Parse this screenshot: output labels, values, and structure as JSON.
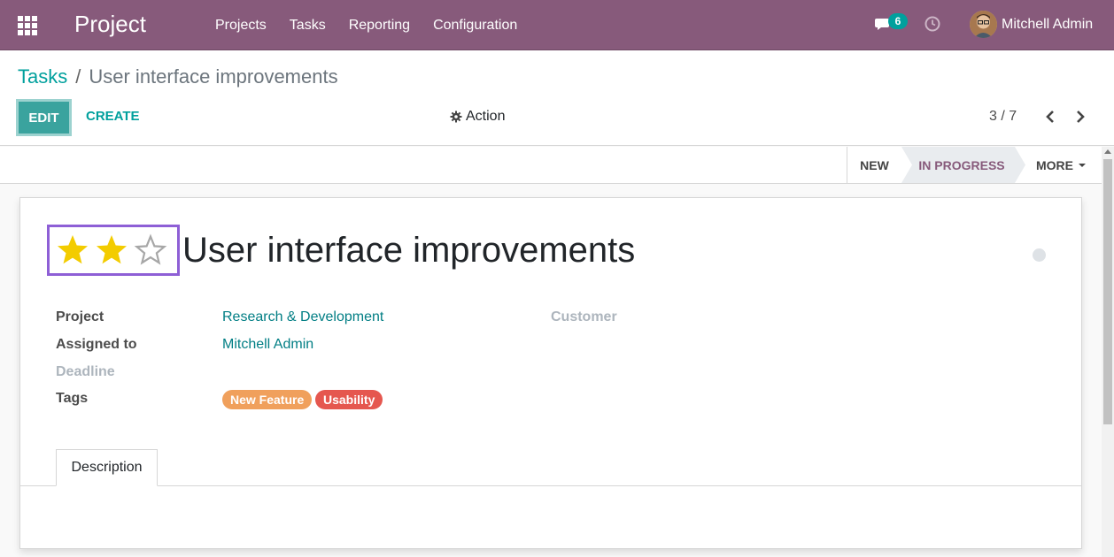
{
  "navbar": {
    "brand": "Project",
    "menu": [
      "Projects",
      "Tasks",
      "Reporting",
      "Configuration"
    ],
    "messages_count": "6",
    "user_name": "Mitchell Admin",
    "color": "#875a7b"
  },
  "breadcrumb": {
    "parent": "Tasks",
    "separator": "/",
    "current": "User interface improvements"
  },
  "toolbar": {
    "edit_label": "EDIT",
    "create_label": "CREATE",
    "action_label": "Action",
    "pager": "3 / 7"
  },
  "stages": {
    "new": "NEW",
    "in_progress": "IN PROGRESS",
    "more": "MORE",
    "active": "IN PROGRESS"
  },
  "task": {
    "priority_stars": 2,
    "priority_max": 3,
    "title": "User interface improvements",
    "fields": {
      "project_label": "Project",
      "project_value": "Research & Development",
      "assigned_label": "Assigned to",
      "assigned_value": "Mitchell Admin",
      "deadline_label": "Deadline",
      "tags_label": "Tags",
      "customer_label": "Customer"
    },
    "tags": [
      {
        "label": "New Feature",
        "color": "#f0a05c"
      },
      {
        "label": "Usability",
        "color": "#e5574f"
      }
    ]
  },
  "tabs": {
    "description": "Description"
  },
  "colors": {
    "accent": "#00a09d",
    "star_filled": "#f3cc00",
    "highlight": "#8e5fd6"
  }
}
